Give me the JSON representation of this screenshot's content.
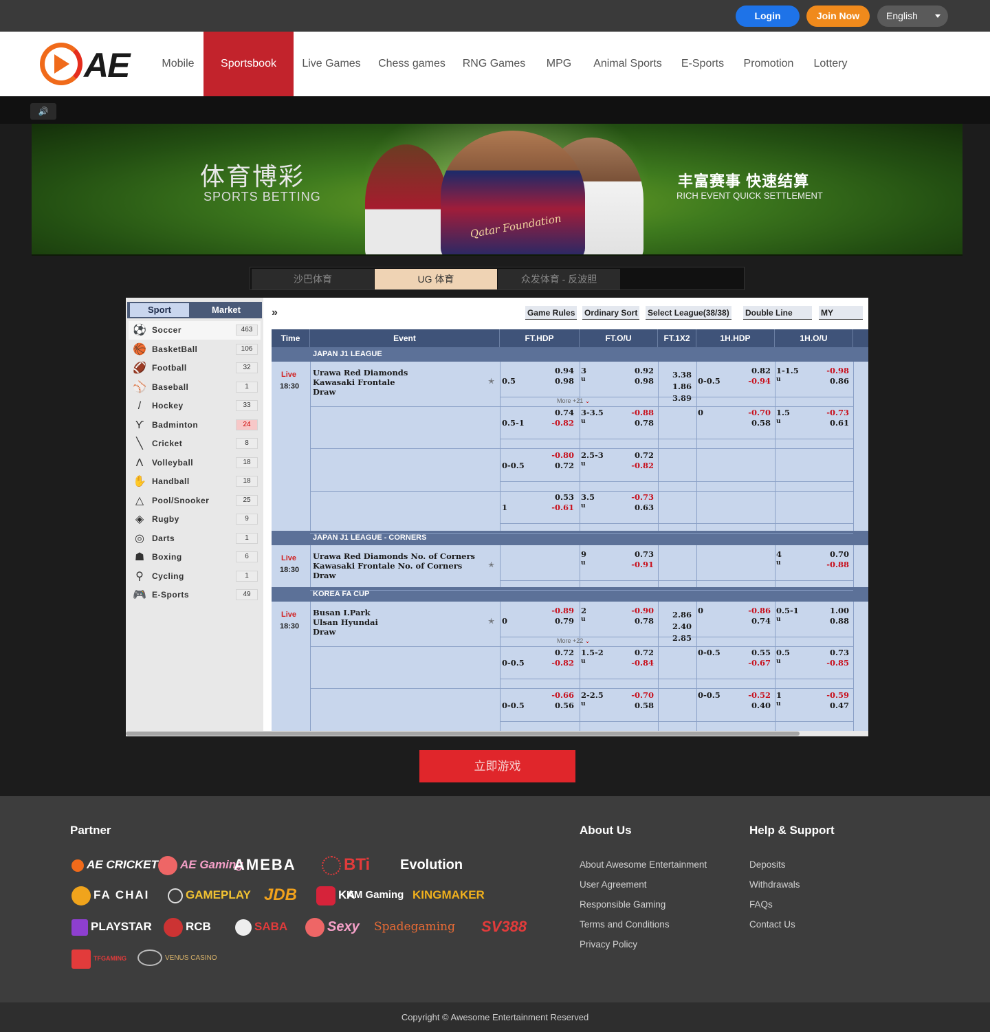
{
  "header": {
    "login_label": "Login",
    "join_label": "Join Now",
    "language": "English",
    "logo_text": "AE"
  },
  "nav": [
    "Mobile",
    "Sportsbook",
    "Live Games",
    "Chess games",
    "RNG Games",
    "MPG",
    "Animal Sports",
    "E-Sports",
    "Promotion",
    "Lottery"
  ],
  "nav_active": "Sportsbook",
  "banner": {
    "title_cn": "体育博彩",
    "title_en": "SPORTS BETTING",
    "slogan_cn": "丰富赛事  快速结算",
    "slogan_en": "RICH EVENT QUICK SETTLEMENT",
    "jersey_text": "Qatar Foundation"
  },
  "provider_tabs": [
    "沙巴体育",
    "UG 体育",
    "众发体育 - 反波胆"
  ],
  "provider_active": "UG 体育",
  "game": {
    "left_tabs": {
      "sport": "Sport",
      "market": "Market"
    },
    "sports": [
      {
        "name": "Soccer",
        "count": "463",
        "icon": "soccer-icon"
      },
      {
        "name": "BasketBall",
        "count": "106",
        "icon": "basketball-icon"
      },
      {
        "name": "Football",
        "count": "32",
        "icon": "football-icon"
      },
      {
        "name": "Baseball",
        "count": "1",
        "icon": "baseball-icon"
      },
      {
        "name": "Hockey",
        "count": "33",
        "icon": "hockey-icon"
      },
      {
        "name": "Badminton",
        "count": "24",
        "icon": "badminton-icon",
        "highlight": true
      },
      {
        "name": "Cricket",
        "count": "8",
        "icon": "cricket-icon"
      },
      {
        "name": "Volleyball",
        "count": "18",
        "icon": "volleyball-icon"
      },
      {
        "name": "Handball",
        "count": "18",
        "icon": "handball-icon"
      },
      {
        "name": "Pool/Snooker",
        "count": "25",
        "icon": "snooker-icon"
      },
      {
        "name": "Rugby",
        "count": "9",
        "icon": "rugby-icon"
      },
      {
        "name": "Darts",
        "count": "1",
        "icon": "darts-icon"
      },
      {
        "name": "Boxing",
        "count": "6",
        "icon": "boxing-icon"
      },
      {
        "name": "Cycling",
        "count": "1",
        "icon": "cycling-icon"
      },
      {
        "name": "E-Sports",
        "count": "49",
        "icon": "esports-icon"
      }
    ],
    "toolbar": {
      "arrows": "»",
      "rules": "Game Rules",
      "sort": "Ordinary Sort",
      "league": "Select League(38/38)",
      "line": "Double Line",
      "odds": "MY"
    },
    "columns": [
      "Time",
      "Event",
      "FT.HDP",
      "FT.O/U",
      "FT.1X2",
      "1H.HDP",
      "1H.O/U"
    ],
    "leagues": [
      {
        "name": "JAPAN J1 LEAGUE",
        "live": "Live",
        "time": "18:30",
        "teams": [
          "Urawa Red Diamonds",
          "Kawasaki Frontale",
          "Draw"
        ],
        "more": "More +21",
        "x12": [
          "3.38",
          "1.86",
          "3.89"
        ]
      },
      {
        "name": "JAPAN J1 LEAGUE - CORNERS",
        "live": "Live",
        "time": "18:30",
        "teams": [
          "Urawa Red Diamonds No. of Corners",
          "Kawasaki Frontale No. of Corners",
          "Draw"
        ]
      },
      {
        "name": "KOREA FA CUP",
        "live": "Live",
        "time": "18:30",
        "teams": [
          "Busan I.Park",
          "Ulsan Hyundai",
          "Draw"
        ],
        "more": "More +22",
        "x12": [
          "2.86",
          "2.40",
          "2.85"
        ]
      }
    ],
    "odds_rows": [
      {
        "hdp": "0.5",
        "hdp_a": "0.94",
        "hdp_b": "0.98",
        "ou": "3",
        "ou_u": "u",
        "ou_a": "0.92",
        "ou_b": "0.98",
        "h1": "0-0.5",
        "h1_a": "0.82",
        "h1_b": "-0.94",
        "h1ou": "1-1.5",
        "h1ou_u": "u",
        "h1ou_a": "-0.98",
        "h1ou_b": "0.86"
      },
      {
        "hdp": "0.5-1",
        "hdp_a": "0.74",
        "hdp_b": "-0.82",
        "ou": "3-3.5",
        "ou_u": "u",
        "ou_a": "-0.88",
        "ou_b": "0.78",
        "h1": "0",
        "h1_a": "-0.70",
        "h1_b": "0.58",
        "h1ou": "1.5",
        "h1ou_u": "u",
        "h1ou_a": "-0.73",
        "h1ou_b": "0.61"
      },
      {
        "hdp": "0-0.5",
        "hdp_a": "-0.80",
        "hdp_b": "0.72",
        "ou": "2.5-3",
        "ou_u": "u",
        "ou_a": "0.72",
        "ou_b": "-0.82"
      },
      {
        "hdp": "1",
        "hdp_a": "0.53",
        "hdp_b": "-0.61",
        "ou": "3.5",
        "ou_u": "u",
        "ou_a": "-0.73",
        "ou_b": "0.63"
      },
      {
        "ou": "9",
        "ou_u": "u",
        "ou_a": "0.73",
        "ou_b": "-0.91",
        "h1ou": "4",
        "h1ou_u": "u",
        "h1ou_a": "0.70",
        "h1ou_b": "-0.88"
      },
      {
        "hdp": "0",
        "hdp_a": "-0.89",
        "hdp_b": "0.79",
        "ou": "2",
        "ou_u": "u",
        "ou_a": "-0.90",
        "ou_b": "0.78",
        "h1": "0",
        "h1_a": "-0.86",
        "h1_b": "0.74",
        "h1ou": "0.5-1",
        "h1ou_u": "u",
        "h1ou_a": "1.00",
        "h1ou_b": "0.88"
      },
      {
        "hdp": "0-0.5",
        "hdp_a": "0.72",
        "hdp_b": "-0.82",
        "ou": "1.5-2",
        "ou_u": "u",
        "ou_a": "0.72",
        "ou_b": "-0.84",
        "h1": "0-0.5",
        "h1_a": "0.55",
        "h1_b": "-0.67",
        "h1ou": "0.5",
        "h1ou_u": "u",
        "h1ou_a": "0.73",
        "h1ou_b": "-0.85"
      },
      {
        "hdp": "0-0.5",
        "hdp_a": "-0.66",
        "hdp_b": "0.56",
        "ou": "2-2.5",
        "ou_u": "u",
        "ou_a": "-0.70",
        "ou_b": "0.58",
        "h1": "0-0.5",
        "h1_a": "-0.52",
        "h1_b": "0.40",
        "h1ou": "1",
        "h1ou_u": "u",
        "h1ou_a": "-0.59",
        "h1ou_b": "0.47"
      }
    ]
  },
  "play_button": "立即游戏",
  "footer": {
    "partner_title": "Partner",
    "partners": [
      "AE CRICKET",
      "AE Gaming",
      "AMEBA",
      "BTi",
      "Evolution",
      "FA CHAI",
      "GAMEPLAY",
      "JDB",
      "KA",
      "KM Gaming",
      "KINGMAKER",
      "PLAYSTAR",
      "RCB",
      "SABA",
      "Sexy",
      "Spadegaming",
      "SV388",
      "TFGAMING",
      "VENUS CASINO"
    ],
    "about_title": "About Us",
    "about_links": [
      "About Awesome Entertainment",
      "User Agreement",
      "Responsible Gaming",
      "Terms and Conditions",
      "Privacy Policy"
    ],
    "help_title": "Help & Support",
    "help_links": [
      "Deposits",
      "Withdrawals",
      "FAQs",
      "Contact Us"
    ],
    "copyright": "Copyright © Awesome Entertainment Reserved"
  },
  "colors": {
    "nav_active": "#c2232c",
    "login": "#1e73e8",
    "join": "#f08a1c",
    "play": "#e0262b",
    "odds_negative": "#c8101c"
  }
}
